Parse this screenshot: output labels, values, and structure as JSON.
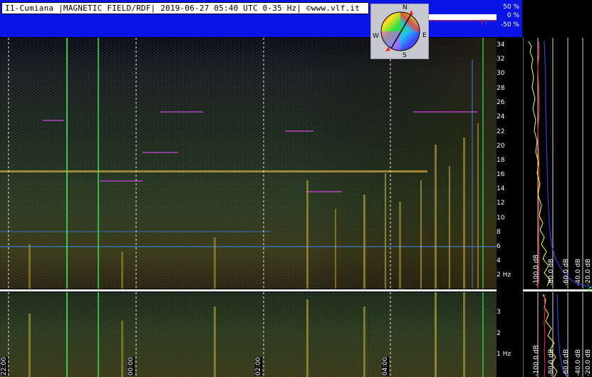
{
  "header": {
    "title": "I1-Cumiana |MAGNETIC FIELD/RDF| 2019-06-27 05:40 UTC 0-35 Hz| ©www.vlf.it"
  },
  "rdf_scale": {
    "labels": [
      "50 %",
      "0 %",
      "-50 %"
    ]
  },
  "compass": {
    "north": "N",
    "south": "S",
    "east": "E",
    "west": "W"
  },
  "freq_axis_main": {
    "labels": [
      "34",
      "32",
      "30",
      "28",
      "26",
      "24",
      "22",
      "20",
      "18",
      "16",
      "14",
      "12",
      "10",
      "8",
      "6",
      "4",
      "2 Hz"
    ]
  },
  "freq_axis_sub": {
    "labels": [
      "3",
      "2",
      "1 Hz"
    ]
  },
  "db_labels_main": [
    "-100.0 dB",
    "-80.0 dB",
    "-60.0 dB",
    "-40.0 dB",
    "-20.0 dB"
  ],
  "db_labels_sub": [
    "-100.0 dB",
    "-80.0 dB",
    "-60.0 dB",
    "-40.0 dB",
    "-20.0 dB"
  ],
  "time_labels": [
    "22:00",
    "00:00",
    "02:00",
    "04:00"
  ],
  "colors": {
    "header_blue": "#0a14e6",
    "background": "#000000",
    "gridline": "#ffffff"
  }
}
